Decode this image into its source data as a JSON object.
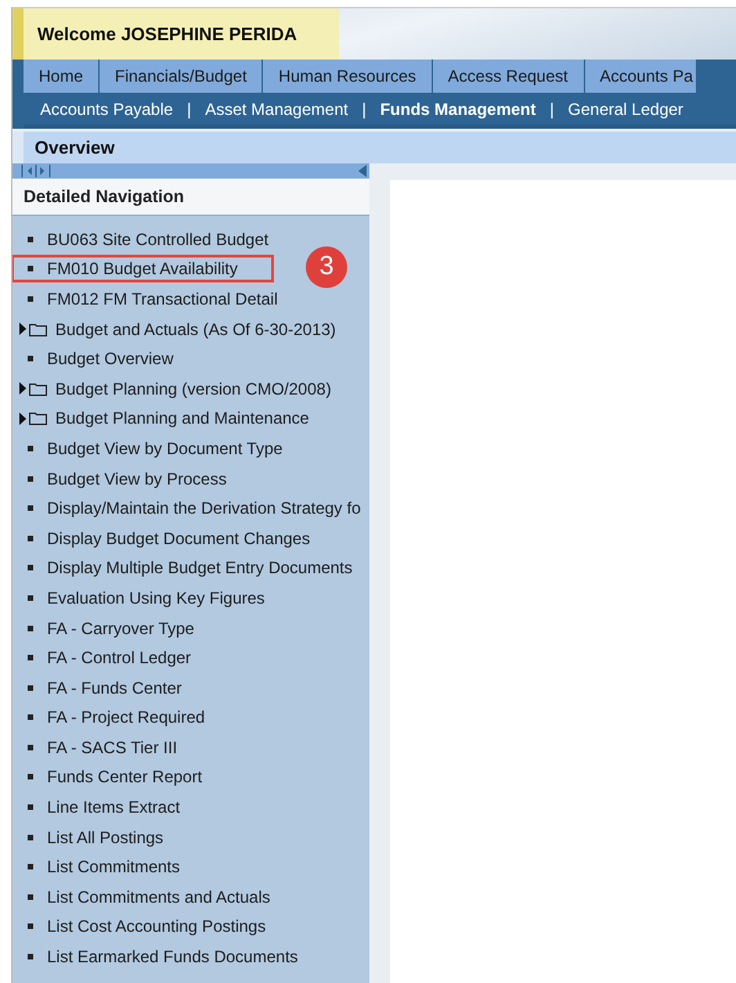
{
  "welcome": "Welcome JOSEPHINE PERIDA",
  "top_tabs": [
    {
      "label": "Home",
      "selected": false
    },
    {
      "label": "Financials/Budget",
      "selected": false
    },
    {
      "label": "Human Resources",
      "selected": false
    },
    {
      "label": "Access Request",
      "selected": false
    },
    {
      "label": "Accounts Pa",
      "selected": false
    }
  ],
  "sub_tab_separator": "|",
  "sub_tabs": [
    {
      "label": "Accounts Payable",
      "selected": false
    },
    {
      "label": "Asset Management",
      "selected": false
    },
    {
      "label": "Funds Management",
      "selected": true
    },
    {
      "label": "General Ledger",
      "selected": false
    }
  ],
  "page_title": "Overview",
  "navigation": {
    "title": "Detailed Navigation",
    "items": [
      {
        "kind": "link",
        "label": "BU063 Site Controlled Budget"
      },
      {
        "kind": "link",
        "label": "FM010 Budget Availability",
        "highlighted": true,
        "callout": "3"
      },
      {
        "kind": "link",
        "label": "FM012 FM Transactional Detail"
      },
      {
        "kind": "folder",
        "label": "Budget and Actuals (As Of 6-30-2013)"
      },
      {
        "kind": "link",
        "label": "Budget Overview"
      },
      {
        "kind": "folder",
        "label": "Budget Planning (version CMO/2008)"
      },
      {
        "kind": "folder",
        "label": "Budget Planning and Maintenance"
      },
      {
        "kind": "link",
        "label": "Budget View by Document Type"
      },
      {
        "kind": "link",
        "label": "Budget View by Process"
      },
      {
        "kind": "link",
        "label": "Display/Maintain the Derivation Strategy fo"
      },
      {
        "kind": "link",
        "label": "Display Budget Document Changes"
      },
      {
        "kind": "link",
        "label": "Display Multiple Budget Entry Documents"
      },
      {
        "kind": "link",
        "label": "Evaluation Using Key Figures"
      },
      {
        "kind": "link",
        "label": "FA - Carryover Type"
      },
      {
        "kind": "link",
        "label": "FA - Control Ledger"
      },
      {
        "kind": "link",
        "label": "FA - Funds Center"
      },
      {
        "kind": "link",
        "label": "FA - Project Required"
      },
      {
        "kind": "link",
        "label": "FA - SACS Tier III"
      },
      {
        "kind": "link",
        "label": "Funds Center Report"
      },
      {
        "kind": "link",
        "label": "Line Items Extract"
      },
      {
        "kind": "link",
        "label": "List All Postings"
      },
      {
        "kind": "link",
        "label": "List Commitments"
      },
      {
        "kind": "link",
        "label": "List Commitments and Actuals"
      },
      {
        "kind": "link",
        "label": "List Cost Accounting Postings"
      },
      {
        "kind": "link",
        "label": "List Earmarked Funds Documents"
      }
    ]
  }
}
